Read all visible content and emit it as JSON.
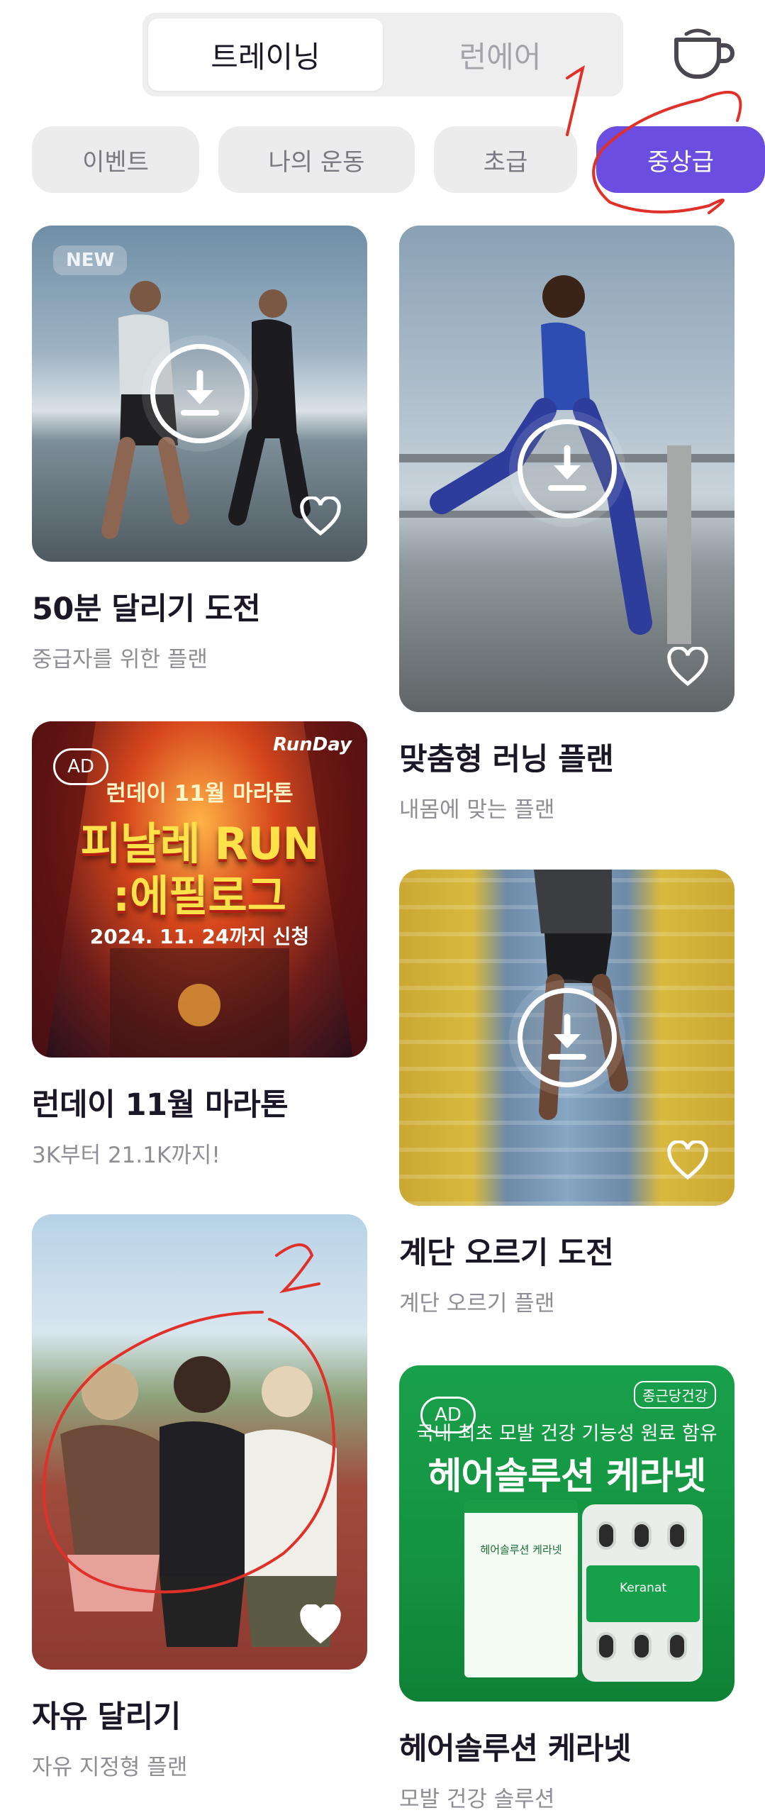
{
  "header": {
    "tabs": [
      {
        "label": "트레이닝",
        "active": true
      },
      {
        "label": "런에어",
        "active": false
      }
    ],
    "cup_icon": "coffee-cup-icon"
  },
  "filters": [
    {
      "label": "이벤트",
      "active": false
    },
    {
      "label": "나의 운동",
      "active": false
    },
    {
      "label": "초급",
      "active": false
    },
    {
      "label": "중상급",
      "active": true
    }
  ],
  "accent_color": "#6b4ee0",
  "cards_left": [
    {
      "badge": "NEW",
      "title": "50분 달리기 도전",
      "subtitle": "중급자를 위한 플랜",
      "downloadable": true
    },
    {
      "badge": "AD",
      "title": "런데이 11월 마라톤",
      "subtitle": "3K부터 21.1K까지!",
      "ad": {
        "brand": "RunDay",
        "line1": "런데이 11월 마라톤",
        "line2": "피날레 RUN",
        "line3": ":에필로그",
        "date": "2024. 11. 24까지 신청"
      }
    },
    {
      "title": "자유 달리기",
      "subtitle": "자유 지정형 플랜",
      "heart_filled": true
    }
  ],
  "cards_right": [
    {
      "title": "맞춤형 러닝 플랜",
      "subtitle": "내몸에 맞는 플랜",
      "downloadable": true
    },
    {
      "title": "계단 오르기 도전",
      "subtitle": "계단 오르기 플랜",
      "downloadable": true
    },
    {
      "badge": "AD",
      "title": "헤어솔루션 케라넷",
      "subtitle": "모발 건강 솔루션",
      "ad": {
        "brand": "종근당건강",
        "line1": "국내 최초 모발 건강 기능성 원료 함유",
        "line2": "헤어솔루션 케라넷",
        "product": "Keranat",
        "product_kr": "헤어솔루션 케라넷"
      }
    }
  ],
  "annotations": {
    "mark1": "1",
    "mark2": "2",
    "color": "#e0302a"
  }
}
